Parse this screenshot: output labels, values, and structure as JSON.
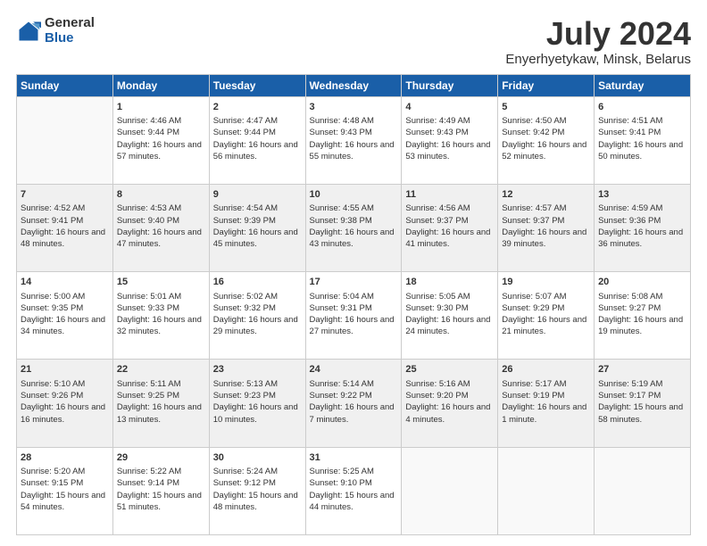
{
  "logo": {
    "general": "General",
    "blue": "Blue"
  },
  "title": "July 2024",
  "subtitle": "Enyerhyetykaw, Minsk, Belarus",
  "weekdays": [
    "Sunday",
    "Monday",
    "Tuesday",
    "Wednesday",
    "Thursday",
    "Friday",
    "Saturday"
  ],
  "weeks": [
    [
      {
        "day": "",
        "sunrise": "",
        "sunset": "",
        "daylight": ""
      },
      {
        "day": "1",
        "sunrise": "Sunrise: 4:46 AM",
        "sunset": "Sunset: 9:44 PM",
        "daylight": "Daylight: 16 hours and 57 minutes."
      },
      {
        "day": "2",
        "sunrise": "Sunrise: 4:47 AM",
        "sunset": "Sunset: 9:44 PM",
        "daylight": "Daylight: 16 hours and 56 minutes."
      },
      {
        "day": "3",
        "sunrise": "Sunrise: 4:48 AM",
        "sunset": "Sunset: 9:43 PM",
        "daylight": "Daylight: 16 hours and 55 minutes."
      },
      {
        "day": "4",
        "sunrise": "Sunrise: 4:49 AM",
        "sunset": "Sunset: 9:43 PM",
        "daylight": "Daylight: 16 hours and 53 minutes."
      },
      {
        "day": "5",
        "sunrise": "Sunrise: 4:50 AM",
        "sunset": "Sunset: 9:42 PM",
        "daylight": "Daylight: 16 hours and 52 minutes."
      },
      {
        "day": "6",
        "sunrise": "Sunrise: 4:51 AM",
        "sunset": "Sunset: 9:41 PM",
        "daylight": "Daylight: 16 hours and 50 minutes."
      }
    ],
    [
      {
        "day": "7",
        "sunrise": "Sunrise: 4:52 AM",
        "sunset": "Sunset: 9:41 PM",
        "daylight": "Daylight: 16 hours and 48 minutes."
      },
      {
        "day": "8",
        "sunrise": "Sunrise: 4:53 AM",
        "sunset": "Sunset: 9:40 PM",
        "daylight": "Daylight: 16 hours and 47 minutes."
      },
      {
        "day": "9",
        "sunrise": "Sunrise: 4:54 AM",
        "sunset": "Sunset: 9:39 PM",
        "daylight": "Daylight: 16 hours and 45 minutes."
      },
      {
        "day": "10",
        "sunrise": "Sunrise: 4:55 AM",
        "sunset": "Sunset: 9:38 PM",
        "daylight": "Daylight: 16 hours and 43 minutes."
      },
      {
        "day": "11",
        "sunrise": "Sunrise: 4:56 AM",
        "sunset": "Sunset: 9:37 PM",
        "daylight": "Daylight: 16 hours and 41 minutes."
      },
      {
        "day": "12",
        "sunrise": "Sunrise: 4:57 AM",
        "sunset": "Sunset: 9:37 PM",
        "daylight": "Daylight: 16 hours and 39 minutes."
      },
      {
        "day": "13",
        "sunrise": "Sunrise: 4:59 AM",
        "sunset": "Sunset: 9:36 PM",
        "daylight": "Daylight: 16 hours and 36 minutes."
      }
    ],
    [
      {
        "day": "14",
        "sunrise": "Sunrise: 5:00 AM",
        "sunset": "Sunset: 9:35 PM",
        "daylight": "Daylight: 16 hours and 34 minutes."
      },
      {
        "day": "15",
        "sunrise": "Sunrise: 5:01 AM",
        "sunset": "Sunset: 9:33 PM",
        "daylight": "Daylight: 16 hours and 32 minutes."
      },
      {
        "day": "16",
        "sunrise": "Sunrise: 5:02 AM",
        "sunset": "Sunset: 9:32 PM",
        "daylight": "Daylight: 16 hours and 29 minutes."
      },
      {
        "day": "17",
        "sunrise": "Sunrise: 5:04 AM",
        "sunset": "Sunset: 9:31 PM",
        "daylight": "Daylight: 16 hours and 27 minutes."
      },
      {
        "day": "18",
        "sunrise": "Sunrise: 5:05 AM",
        "sunset": "Sunset: 9:30 PM",
        "daylight": "Daylight: 16 hours and 24 minutes."
      },
      {
        "day": "19",
        "sunrise": "Sunrise: 5:07 AM",
        "sunset": "Sunset: 9:29 PM",
        "daylight": "Daylight: 16 hours and 21 minutes."
      },
      {
        "day": "20",
        "sunrise": "Sunrise: 5:08 AM",
        "sunset": "Sunset: 9:27 PM",
        "daylight": "Daylight: 16 hours and 19 minutes."
      }
    ],
    [
      {
        "day": "21",
        "sunrise": "Sunrise: 5:10 AM",
        "sunset": "Sunset: 9:26 PM",
        "daylight": "Daylight: 16 hours and 16 minutes."
      },
      {
        "day": "22",
        "sunrise": "Sunrise: 5:11 AM",
        "sunset": "Sunset: 9:25 PM",
        "daylight": "Daylight: 16 hours and 13 minutes."
      },
      {
        "day": "23",
        "sunrise": "Sunrise: 5:13 AM",
        "sunset": "Sunset: 9:23 PM",
        "daylight": "Daylight: 16 hours and 10 minutes."
      },
      {
        "day": "24",
        "sunrise": "Sunrise: 5:14 AM",
        "sunset": "Sunset: 9:22 PM",
        "daylight": "Daylight: 16 hours and 7 minutes."
      },
      {
        "day": "25",
        "sunrise": "Sunrise: 5:16 AM",
        "sunset": "Sunset: 9:20 PM",
        "daylight": "Daylight: 16 hours and 4 minutes."
      },
      {
        "day": "26",
        "sunrise": "Sunrise: 5:17 AM",
        "sunset": "Sunset: 9:19 PM",
        "daylight": "Daylight: 16 hours and 1 minute."
      },
      {
        "day": "27",
        "sunrise": "Sunrise: 5:19 AM",
        "sunset": "Sunset: 9:17 PM",
        "daylight": "Daylight: 15 hours and 58 minutes."
      }
    ],
    [
      {
        "day": "28",
        "sunrise": "Sunrise: 5:20 AM",
        "sunset": "Sunset: 9:15 PM",
        "daylight": "Daylight: 15 hours and 54 minutes."
      },
      {
        "day": "29",
        "sunrise": "Sunrise: 5:22 AM",
        "sunset": "Sunset: 9:14 PM",
        "daylight": "Daylight: 15 hours and 51 minutes."
      },
      {
        "day": "30",
        "sunrise": "Sunrise: 5:24 AM",
        "sunset": "Sunset: 9:12 PM",
        "daylight": "Daylight: 15 hours and 48 minutes."
      },
      {
        "day": "31",
        "sunrise": "Sunrise: 5:25 AM",
        "sunset": "Sunset: 9:10 PM",
        "daylight": "Daylight: 15 hours and 44 minutes."
      },
      {
        "day": "",
        "sunrise": "",
        "sunset": "",
        "daylight": ""
      },
      {
        "day": "",
        "sunrise": "",
        "sunset": "",
        "daylight": ""
      },
      {
        "day": "",
        "sunrise": "",
        "sunset": "",
        "daylight": ""
      }
    ]
  ]
}
